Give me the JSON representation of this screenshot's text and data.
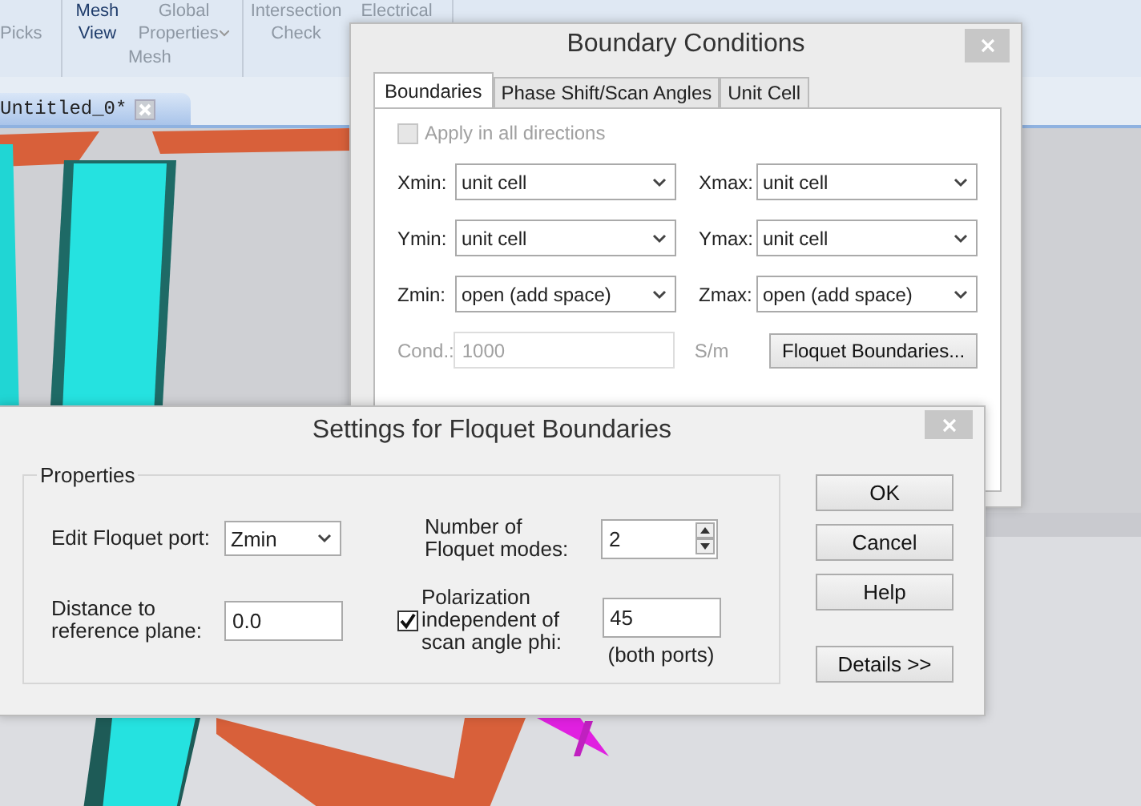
{
  "ribbon": {
    "buttons": [
      {
        "bottom": "Picks",
        "disabled": true
      },
      {
        "top": "Mesh",
        "bottom": "View",
        "disabled": false
      },
      {
        "top": "Global",
        "bottom": "Properties",
        "dropdown": true,
        "disabled": true
      },
      {
        "top": "Intersection",
        "bottom": "Check",
        "disabled": true
      },
      {
        "top": "Electrical",
        "disabled": true
      }
    ],
    "group_label": "Mesh"
  },
  "document_tabs": [
    {
      "label": "Untitled_0*",
      "selected": true
    }
  ],
  "boundary_dialog": {
    "title": "Boundary Conditions",
    "tabs": [
      {
        "label": "Boundaries",
        "selected": true
      },
      {
        "label": "Phase Shift/Scan Angles",
        "selected": false
      },
      {
        "label": "Unit Cell",
        "selected": false
      }
    ],
    "apply_all": {
      "label": "Apply in all directions",
      "checked": false,
      "disabled": true
    },
    "fields": [
      {
        "label": "Xmin:",
        "value": "unit cell"
      },
      {
        "label": "Xmax:",
        "value": "unit cell"
      },
      {
        "label": "Ymin:",
        "value": "unit cell"
      },
      {
        "label": "Ymax:",
        "value": "unit cell"
      },
      {
        "label": "Zmin:",
        "value": "open (add space)"
      },
      {
        "label": "Zmax:",
        "value": "open (add space)"
      }
    ],
    "conductivity": {
      "label": "Cond.:",
      "value": "1000",
      "unit": "S/m",
      "disabled": true
    },
    "floquet_button": "Floquet Boundaries..."
  },
  "floquet_dialog": {
    "title": "Settings for Floquet Boundaries",
    "group_title": "Properties",
    "port": {
      "label": "Edit Floquet port:",
      "value": "Zmin"
    },
    "modes": {
      "label": "Number of\nFloquet modes:",
      "value": "2"
    },
    "distance": {
      "label": "Distance to\nreference plane:",
      "value": "0.0"
    },
    "polarization": {
      "label": "Polarization\nindependent of\nscan angle phi:",
      "checked": true,
      "value": "45",
      "note": "(both ports)"
    },
    "buttons": [
      "OK",
      "Cancel",
      "Help",
      "Details >>"
    ]
  }
}
